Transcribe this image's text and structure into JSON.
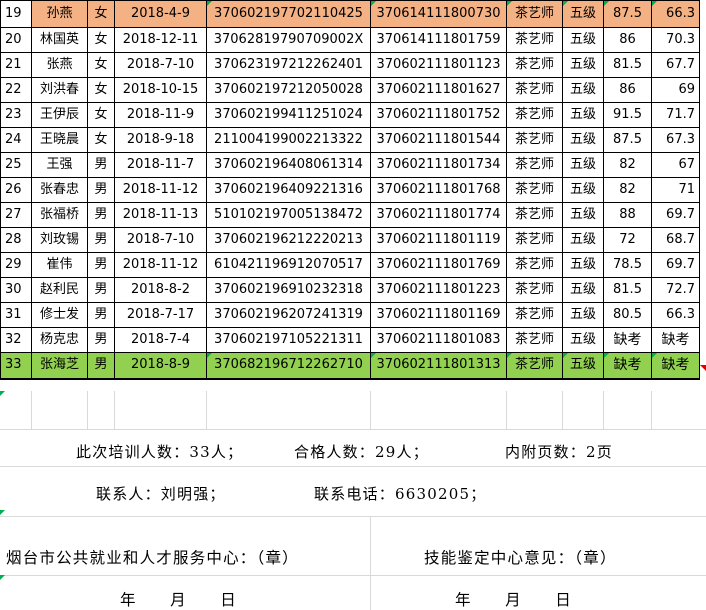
{
  "table": {
    "rows": [
      {
        "no": "19",
        "name": "孙燕",
        "sex": "女",
        "date": "2018-4-9",
        "id": "370602197702110425",
        "cert": "370614111800730",
        "job": "茶艺师",
        "level": "五级",
        "s1": "87.5",
        "s2": "66.3",
        "style": "orange"
      },
      {
        "no": "20",
        "name": "林国英",
        "sex": "女",
        "date": "2018-12-11",
        "id": "37062819790709002X",
        "cert": "370614111801759",
        "job": "茶艺师",
        "level": "五级",
        "s1": "86",
        "s2": "70.3",
        "style": ""
      },
      {
        "no": "21",
        "name": "张燕",
        "sex": "女",
        "date": "2018-7-10",
        "id": "370623197212262401",
        "cert": "370602111801123",
        "job": "茶艺师",
        "level": "五级",
        "s1": "81.5",
        "s2": "67.7",
        "style": ""
      },
      {
        "no": "22",
        "name": "刘洪春",
        "sex": "女",
        "date": "2018-10-15",
        "id": "370602197212050028",
        "cert": "370602111801627",
        "job": "茶艺师",
        "level": "五级",
        "s1": "86",
        "s2": "69",
        "style": ""
      },
      {
        "no": "23",
        "name": "王伊辰",
        "sex": "女",
        "date": "2018-11-9",
        "id": "370602199411251024",
        "cert": "370602111801752",
        "job": "茶艺师",
        "level": "五级",
        "s1": "91.5",
        "s2": "71.7",
        "style": ""
      },
      {
        "no": "24",
        "name": "王晓晨",
        "sex": "女",
        "date": "2018-9-18",
        "id": "211004199002213322",
        "cert": "370602111801544",
        "job": "茶艺师",
        "level": "五级",
        "s1": "87.5",
        "s2": "67.3",
        "style": ""
      },
      {
        "no": "25",
        "name": "王强",
        "sex": "男",
        "date": "2018-11-7",
        "id": "370602196408061314",
        "cert": "370602111801734",
        "job": "茶艺师",
        "level": "五级",
        "s1": "82",
        "s2": "67",
        "style": ""
      },
      {
        "no": "26",
        "name": "张春忠",
        "sex": "男",
        "date": "2018-11-12",
        "id": "370602196409221316",
        "cert": "370602111801768",
        "job": "茶艺师",
        "level": "五级",
        "s1": "82",
        "s2": "71",
        "style": ""
      },
      {
        "no": "27",
        "name": "张福桥",
        "sex": "男",
        "date": "2018-11-13",
        "id": "510102197005138472",
        "cert": "370602111801774",
        "job": "茶艺师",
        "level": "五级",
        "s1": "88",
        "s2": "69.7",
        "style": ""
      },
      {
        "no": "28",
        "name": "刘玫锡",
        "sex": "男",
        "date": "2018-7-10",
        "id": "370602196212220213",
        "cert": "370602111801119",
        "job": "茶艺师",
        "level": "五级",
        "s1": "72",
        "s2": "68.7",
        "style": ""
      },
      {
        "no": "29",
        "name": "崔伟",
        "sex": "男",
        "date": "2018-11-12",
        "id": "610421196912070517",
        "cert": "370602111801769",
        "job": "茶艺师",
        "level": "五级",
        "s1": "78.5",
        "s2": "69.7",
        "style": ""
      },
      {
        "no": "30",
        "name": "赵利民",
        "sex": "男",
        "date": "2018-8-2",
        "id": "370602196910232318",
        "cert": "370602111801223",
        "job": "茶艺师",
        "level": "五级",
        "s1": "81.5",
        "s2": "72.7",
        "style": ""
      },
      {
        "no": "31",
        "name": "修士发",
        "sex": "男",
        "date": "2018-7-17",
        "id": "370602196207241319",
        "cert": "370602111801169",
        "job": "茶艺师",
        "level": "五级",
        "s1": "80.5",
        "s2": "66.3",
        "style": ""
      },
      {
        "no": "32",
        "name": "杨克忠",
        "sex": "男",
        "date": "2018-7-4",
        "id": "370602197105221311",
        "cert": "370602111801083",
        "job": "茶艺师",
        "level": "五级",
        "s1": "缺考",
        "s2": "缺考",
        "style": ""
      },
      {
        "no": "33",
        "name": "张海芝",
        "sex": "男",
        "date": "2018-8-9",
        "id": "370682196712262710",
        "cert": "370602111801313",
        "job": "茶艺师",
        "level": "五级",
        "s1": "缺考",
        "s2": "缺考",
        "style": "green"
      }
    ]
  },
  "footer": {
    "line1_count": "此次培训人数：33人；",
    "line1_pass": "合格人数：29人；",
    "line1_pages": "内附页数：2页",
    "line2_contact": "联系人：刘明强；",
    "line2_phone": "联系电话：6630205；",
    "org_left": "烟台市公共就业和人才服务中心：（章）",
    "org_right": "技能鉴定中心意见：（章）",
    "date_left": "年　　月　　日",
    "date_right": "年　　月　　日"
  },
  "colors": {
    "highlight_orange": "#f4b183",
    "highlight_green": "#92d050",
    "comment_marker": "#00b050"
  }
}
